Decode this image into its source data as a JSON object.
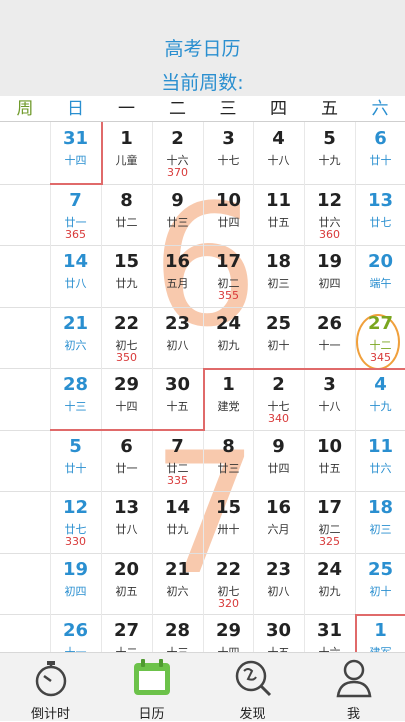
{
  "header": {
    "title": "高考日历",
    "subtitle": "当前周数:"
  },
  "weekdays": [
    "周",
    "日",
    "一",
    "二",
    "三",
    "四",
    "五",
    "六"
  ],
  "watermarks": [
    "6",
    "7"
  ],
  "weeks": [
    [
      {
        "d": "31",
        "l": "十四"
      },
      {
        "d": "1",
        "l": "儿童"
      },
      {
        "d": "2",
        "l": "十六",
        "n": "370"
      },
      {
        "d": "3",
        "l": "十七"
      },
      {
        "d": "4",
        "l": "十八"
      },
      {
        "d": "5",
        "l": "十九"
      },
      {
        "d": "6",
        "l": "廿十"
      }
    ],
    [
      {
        "d": "7",
        "l": "廿一",
        "n": "365"
      },
      {
        "d": "8",
        "l": "廿二"
      },
      {
        "d": "9",
        "l": "廿三"
      },
      {
        "d": "10",
        "l": "廿四"
      },
      {
        "d": "11",
        "l": "廿五"
      },
      {
        "d": "12",
        "l": "廿六",
        "n": "360"
      },
      {
        "d": "13",
        "l": "廿七"
      }
    ],
    [
      {
        "d": "14",
        "l": "廿八"
      },
      {
        "d": "15",
        "l": "廿九"
      },
      {
        "d": "16",
        "l": "五月"
      },
      {
        "d": "17",
        "l": "初二",
        "n": "355"
      },
      {
        "d": "18",
        "l": "初三"
      },
      {
        "d": "19",
        "l": "初四"
      },
      {
        "d": "20",
        "l": "端午"
      }
    ],
    [
      {
        "d": "21",
        "l": "初六"
      },
      {
        "d": "22",
        "l": "初七",
        "n": "350"
      },
      {
        "d": "23",
        "l": "初八"
      },
      {
        "d": "24",
        "l": "初九"
      },
      {
        "d": "25",
        "l": "初十"
      },
      {
        "d": "26",
        "l": "十一"
      },
      {
        "d": "27",
        "l": "十二",
        "n": "345"
      }
    ],
    [
      {
        "d": "28",
        "l": "十三"
      },
      {
        "d": "29",
        "l": "十四"
      },
      {
        "d": "30",
        "l": "十五"
      },
      {
        "d": "1",
        "l": "建党"
      },
      {
        "d": "2",
        "l": "十七",
        "n": "340"
      },
      {
        "d": "3",
        "l": "十八"
      },
      {
        "d": "4",
        "l": "十九"
      }
    ],
    [
      {
        "d": "5",
        "l": "廿十"
      },
      {
        "d": "6",
        "l": "廿一"
      },
      {
        "d": "7",
        "l": "廿二",
        "n": "335"
      },
      {
        "d": "8",
        "l": "廿三"
      },
      {
        "d": "9",
        "l": "廿四"
      },
      {
        "d": "10",
        "l": "廿五"
      },
      {
        "d": "11",
        "l": "廿六"
      }
    ],
    [
      {
        "d": "12",
        "l": "廿七",
        "n": "330"
      },
      {
        "d": "13",
        "l": "廿八"
      },
      {
        "d": "14",
        "l": "廿九"
      },
      {
        "d": "15",
        "l": "卅十"
      },
      {
        "d": "16",
        "l": "六月"
      },
      {
        "d": "17",
        "l": "初二",
        "n": "325"
      },
      {
        "d": "18",
        "l": "初三"
      }
    ],
    [
      {
        "d": "19",
        "l": "初四"
      },
      {
        "d": "20",
        "l": "初五"
      },
      {
        "d": "21",
        "l": "初六"
      },
      {
        "d": "22",
        "l": "初七",
        "n": "320"
      },
      {
        "d": "23",
        "l": "初八"
      },
      {
        "d": "24",
        "l": "初九"
      },
      {
        "d": "25",
        "l": "初十"
      }
    ],
    [
      {
        "d": "26",
        "l": "十一"
      },
      {
        "d": "27",
        "l": "十二"
      },
      {
        "d": "28",
        "l": "十三"
      },
      {
        "d": "29",
        "l": "十四"
      },
      {
        "d": "30",
        "l": "十五"
      },
      {
        "d": "31",
        "l": "十六"
      },
      {
        "d": "1",
        "l": "建军"
      }
    ]
  ],
  "today": {
    "week": 3,
    "col": 6
  },
  "tabs": [
    {
      "label": "倒计时",
      "icon": "stopwatch-icon"
    },
    {
      "label": "日历",
      "icon": "calendar-icon",
      "active": true
    },
    {
      "label": "发现",
      "icon": "discover-icon"
    },
    {
      "label": "我",
      "icon": "person-icon"
    }
  ],
  "colors": {
    "accent": "#2a8fd0",
    "today": "#7aa61f",
    "countdown": "#d83a3a",
    "watermark": "#f7c09f",
    "ring": "#f0a03c"
  }
}
